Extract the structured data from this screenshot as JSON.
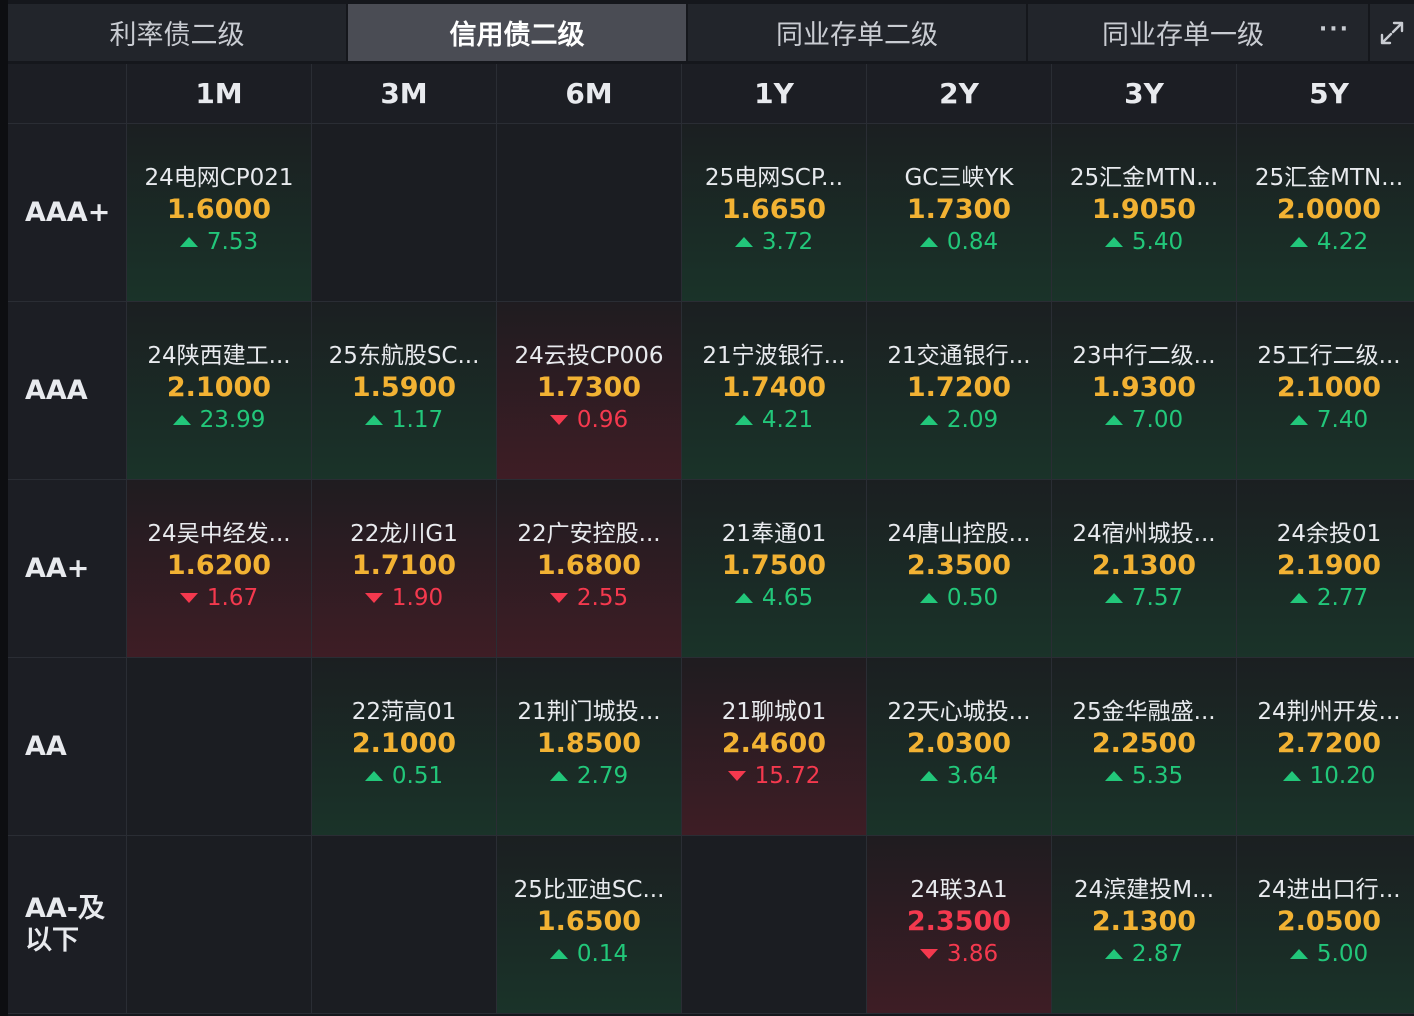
{
  "tabs": [
    {
      "label": "利率债二级",
      "active": false
    },
    {
      "label": "信用债二级",
      "active": true
    },
    {
      "label": "同业存单二级",
      "active": false
    },
    {
      "label": "同业存单一级",
      "active": false
    }
  ],
  "more_label": "···",
  "columns": [
    "1M",
    "3M",
    "6M",
    "1Y",
    "2Y",
    "3Y",
    "5Y"
  ],
  "ratings": [
    "AAA+",
    "AAA",
    "AA+",
    "AA",
    "AA-及\n以下"
  ],
  "colors": {
    "up": "#22c77a",
    "down": "#f4394e",
    "rate": "#f2b233"
  },
  "rows": [
    {
      "rating": "AAA+",
      "cells": [
        {
          "name": "24电网CP021",
          "rate": "1.6000",
          "change": "7.53",
          "dir": "up"
        },
        null,
        null,
        {
          "name": "25电网SCP...",
          "rate": "1.6650",
          "change": "3.72",
          "dir": "up"
        },
        {
          "name": "GC三峡YK",
          "rate": "1.7300",
          "change": "0.84",
          "dir": "up"
        },
        {
          "name": "25汇金MTN...",
          "rate": "1.9050",
          "change": "5.40",
          "dir": "up"
        },
        {
          "name": "25汇金MTN...",
          "rate": "2.0000",
          "change": "4.22",
          "dir": "up"
        }
      ]
    },
    {
      "rating": "AAA",
      "cells": [
        {
          "name": "24陕西建工...",
          "rate": "2.1000",
          "change": "23.99",
          "dir": "up"
        },
        {
          "name": "25东航股SC...",
          "rate": "1.5900",
          "change": "1.17",
          "dir": "up"
        },
        {
          "name": "24云投CP006",
          "rate": "1.7300",
          "change": "0.96",
          "dir": "down"
        },
        {
          "name": "21宁波银行...",
          "rate": "1.7400",
          "change": "4.21",
          "dir": "up"
        },
        {
          "name": "21交通银行...",
          "rate": "1.7200",
          "change": "2.09",
          "dir": "up"
        },
        {
          "name": "23中行二级...",
          "rate": "1.9300",
          "change": "7.00",
          "dir": "up"
        },
        {
          "name": "25工行二级...",
          "rate": "2.1000",
          "change": "7.40",
          "dir": "up"
        }
      ]
    },
    {
      "rating": "AA+",
      "cells": [
        {
          "name": "24吴中经发...",
          "rate": "1.6200",
          "change": "1.67",
          "dir": "down"
        },
        {
          "name": "22龙川G1",
          "rate": "1.7100",
          "change": "1.90",
          "dir": "down"
        },
        {
          "name": "22广安控股...",
          "rate": "1.6800",
          "change": "2.55",
          "dir": "down"
        },
        {
          "name": "21奉通01",
          "rate": "1.7500",
          "change": "4.65",
          "dir": "up"
        },
        {
          "name": "24唐山控股...",
          "rate": "2.3500",
          "change": "0.50",
          "dir": "up"
        },
        {
          "name": "24宿州城投...",
          "rate": "2.1300",
          "change": "7.57",
          "dir": "up"
        },
        {
          "name": "24余投01",
          "rate": "2.1900",
          "change": "2.77",
          "dir": "up"
        }
      ]
    },
    {
      "rating": "AA",
      "cells": [
        null,
        {
          "name": "22菏高01",
          "rate": "2.1000",
          "change": "0.51",
          "dir": "up"
        },
        {
          "name": "21荆门城投...",
          "rate": "1.8500",
          "change": "2.79",
          "dir": "up"
        },
        {
          "name": "21聊城01",
          "rate": "2.4600",
          "change": "15.72",
          "dir": "down"
        },
        {
          "name": "22天心城投...",
          "rate": "2.0300",
          "change": "3.64",
          "dir": "up"
        },
        {
          "name": "25金华融盛...",
          "rate": "2.2500",
          "change": "5.35",
          "dir": "up"
        },
        {
          "name": "24荆州开发...",
          "rate": "2.7200",
          "change": "10.20",
          "dir": "up"
        }
      ]
    },
    {
      "rating": "AA-及以下",
      "cells": [
        null,
        null,
        {
          "name": "25比亚迪SC...",
          "rate": "1.6500",
          "change": "0.14",
          "dir": "up"
        },
        null,
        {
          "name": "24联3A1",
          "rate": "2.3500",
          "change": "3.86",
          "dir": "down",
          "rate_red": true
        },
        {
          "name": "24滨建投M...",
          "rate": "2.1300",
          "change": "2.87",
          "dir": "up"
        },
        {
          "name": "24进出口行...",
          "rate": "2.0500",
          "change": "5.00",
          "dir": "up"
        }
      ]
    }
  ]
}
